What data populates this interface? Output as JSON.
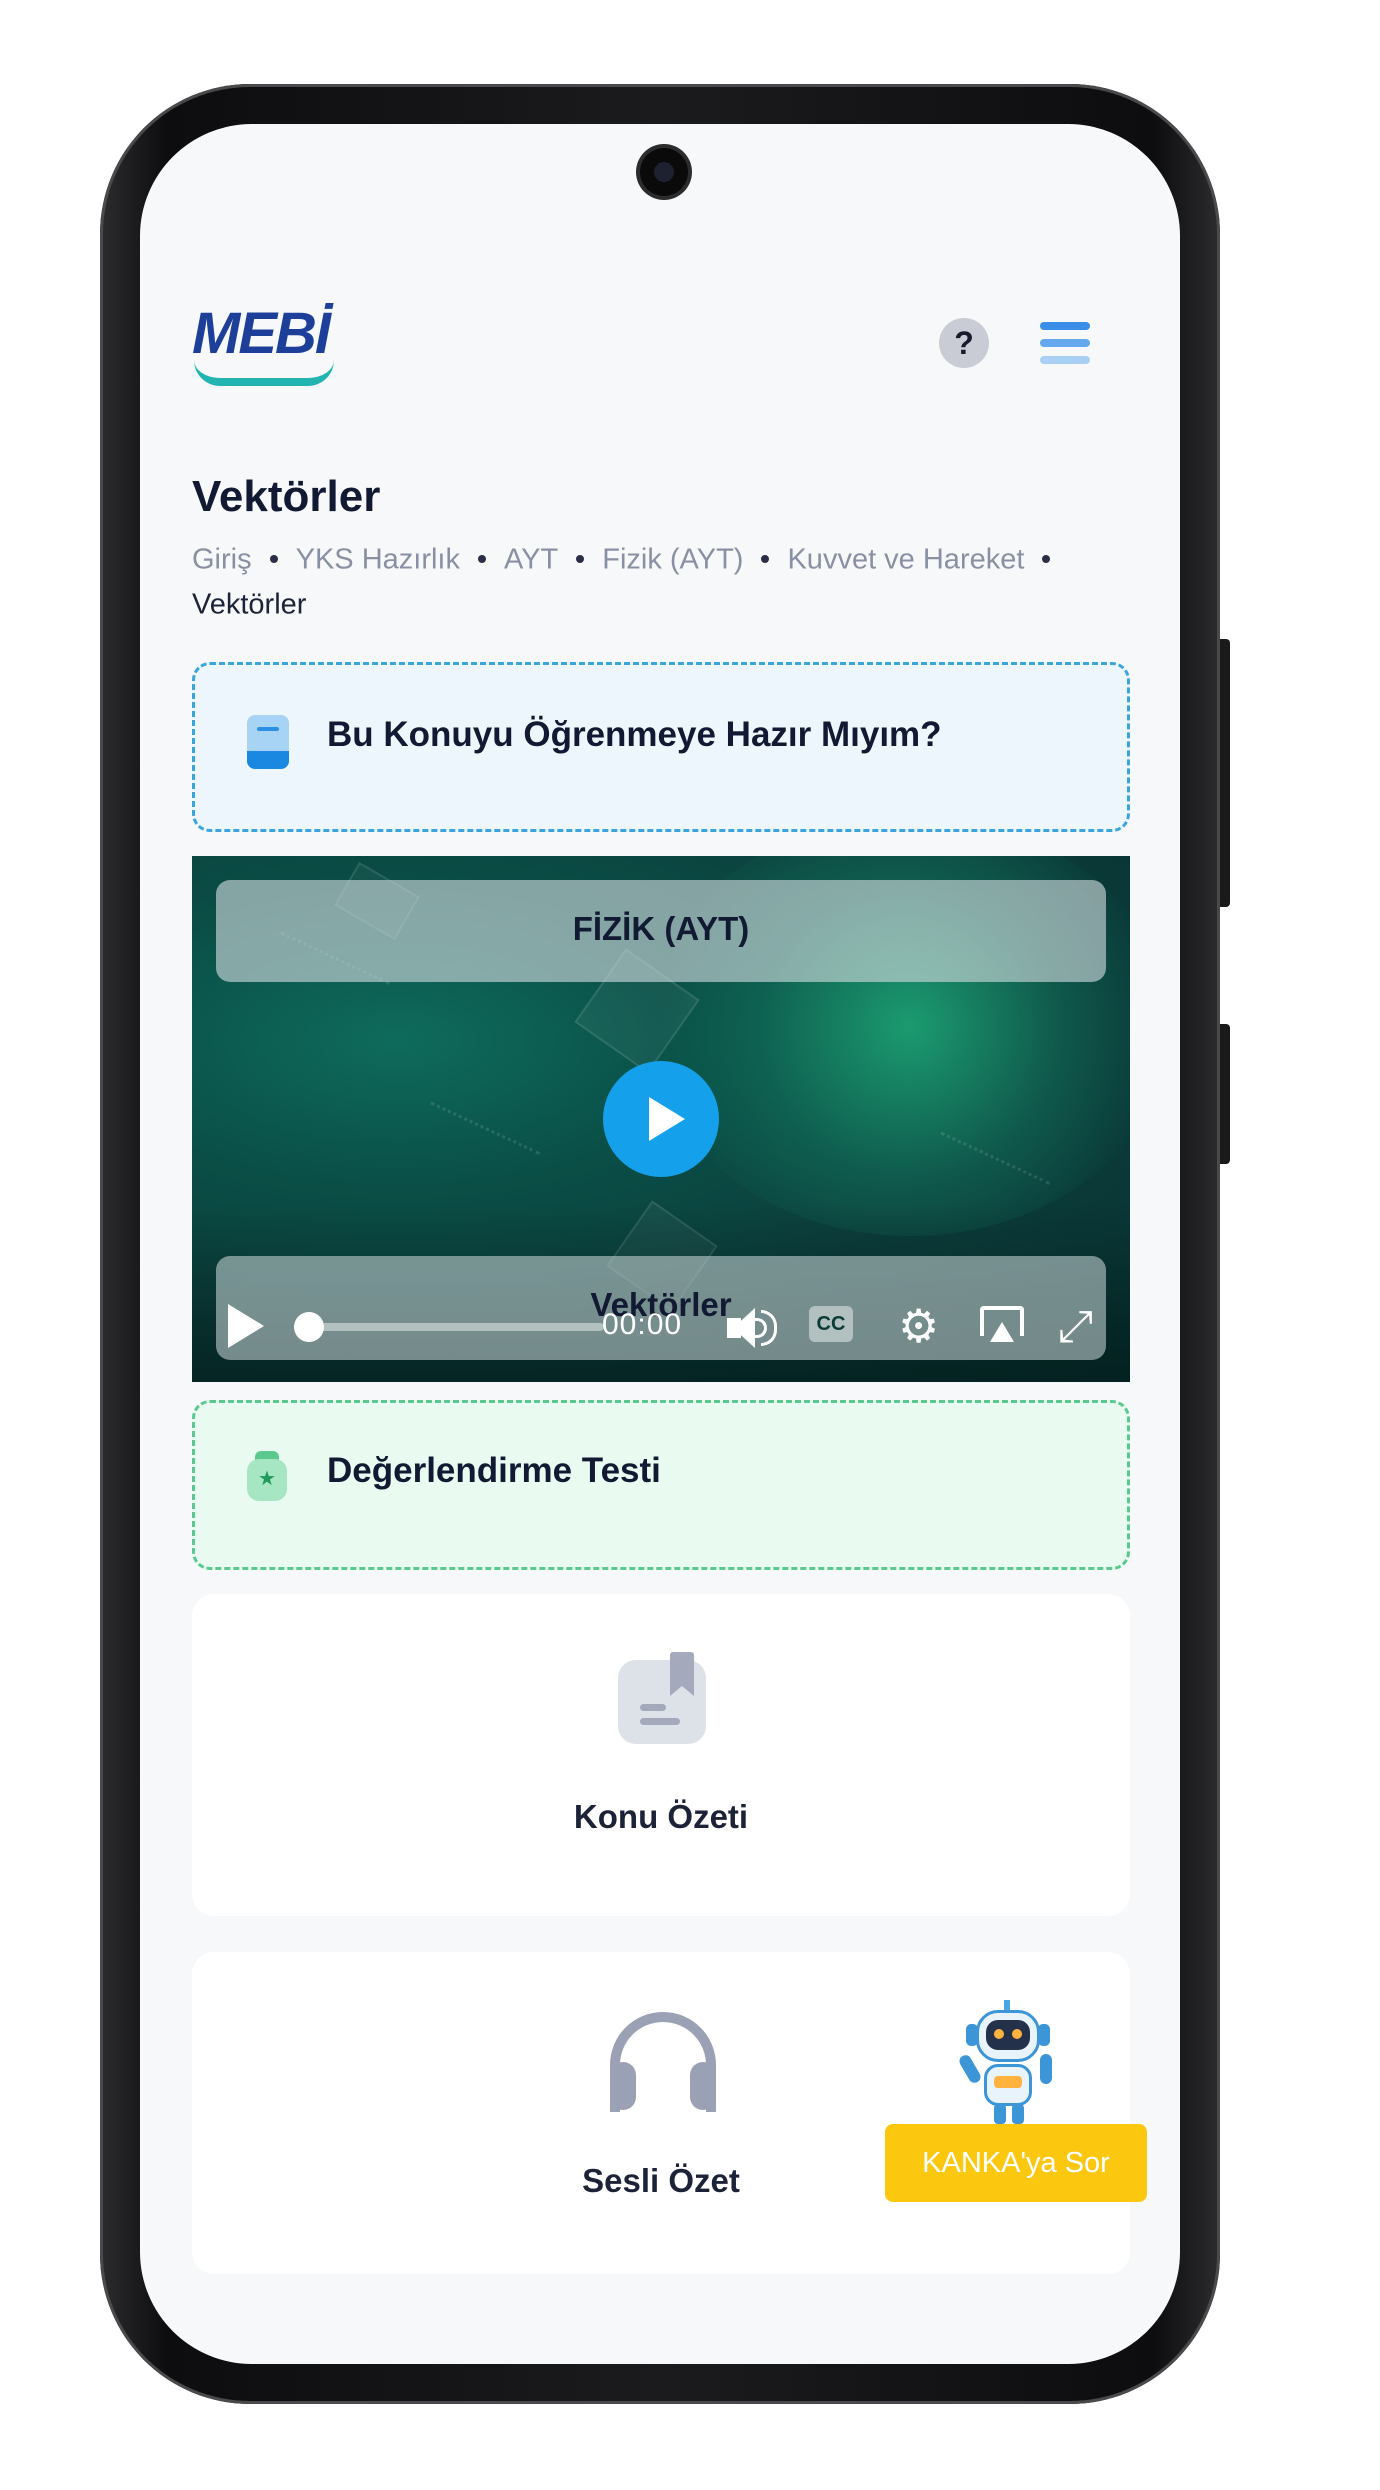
{
  "header": {
    "logo_text": "MEBİ",
    "help_label": "?"
  },
  "page": {
    "title": "Vektörler",
    "breadcrumb": [
      "Giriş",
      "YKS Hazırlık",
      "AYT",
      "Fizik (AYT)",
      "Kuvvet ve Hareket",
      "Vektörler"
    ]
  },
  "readiness_card": {
    "label": "Bu Konuyu Öğrenmeye Hazır Mıyım?",
    "icon": "book-icon"
  },
  "video": {
    "top_title": "FİZİK (AYT)",
    "bottom_title": "Vektörler",
    "time": "00:00",
    "progress": 0,
    "cc_label": "CC",
    "controls": [
      "play-icon",
      "volume-icon",
      "captions-icon",
      "settings-icon",
      "airplay-icon",
      "fullscreen-icon"
    ]
  },
  "test_card": {
    "label": "Değerlendirme Testi",
    "icon": "badge-icon"
  },
  "tiles": [
    {
      "label": "Konu Özeti",
      "icon": "document-bookmark-icon"
    },
    {
      "label": "Sesli Özet",
      "icon": "headphones-icon"
    }
  ],
  "assistant": {
    "button_label": "KANKA'ya Sor",
    "icon": "robot-icon"
  },
  "colors": {
    "accent_blue": "#14a0ea",
    "ready_border": "#3ba4dd",
    "test_border": "#5bc98e",
    "ask_button": "#fbc70f",
    "brand": "#1d3f9a",
    "brand_teal": "#22b5b0"
  }
}
